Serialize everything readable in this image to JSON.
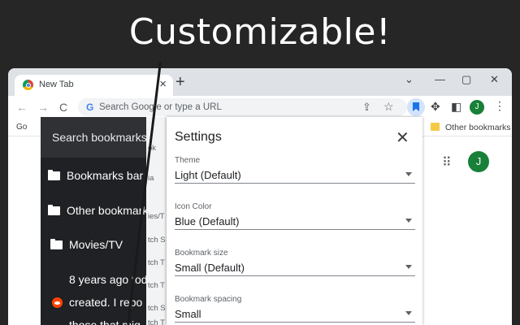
{
  "headline": "Customizable!",
  "tabstrip": {
    "tab_title": "New Tab",
    "tab_close": "×",
    "new_tab": "+",
    "window_controls": [
      "⌄",
      "—",
      "▢",
      "✕"
    ]
  },
  "toolbar": {
    "back": "←",
    "forward": "→",
    "reload": "C",
    "omnibox_placeholder": "Search Google or type a URL",
    "google_glyph": "G",
    "share_glyph": "⇪",
    "star_glyph": "☆",
    "extensions_glyph": "✥",
    "sidepanel_glyph": "◧",
    "avatar_letter": "J",
    "menu_glyph": "⋮"
  },
  "bookmarks_bar": {
    "left_fragment": "Go",
    "other_bookmarks": "Other bookmarks"
  },
  "ntp": {
    "apps_glyph": "⠿",
    "avatar_letter": "J"
  },
  "sidebar": {
    "search_placeholder": "Search bookmarks",
    "items": [
      {
        "label": "Bookmarks bar"
      },
      {
        "label": "Other bookmark"
      },
      {
        "label": "Movies/TV"
      }
    ],
    "post_lines": [
      "8 years ago tod",
      "created. I repo",
      "those that mig"
    ]
  },
  "strip_lines": [
    "ok",
    "ia",
    "ies/T",
    "tch S",
    "tch T",
    "tch T",
    "tch S",
    "tch T"
  ],
  "settings": {
    "title": "Settings",
    "close_glyph": "✕",
    "fields": [
      {
        "label": "Theme",
        "value": "Light (Default)"
      },
      {
        "label": "Icon Color",
        "value": "Blue (Default)"
      },
      {
        "label": "Bookmark size",
        "value": "Small (Default)"
      },
      {
        "label": "Bookmark spacing",
        "value": "Small"
      }
    ]
  },
  "colors": {
    "background": "#262626",
    "sidebar_dark": "#202124",
    "accent_blue": "#1a73e8",
    "avatar_green": "#188038",
    "folder_yellow": "#f6c945",
    "reddit_orange": "#ff4500"
  },
  "icons": [
    "chrome-icon",
    "google-icon",
    "share-icon",
    "star-icon",
    "bookmark-extension-icon",
    "puzzle-icon",
    "side-panel-icon",
    "kebab-menu-icon",
    "folder-icon",
    "apps-grid-icon",
    "reddit-icon",
    "close-icon",
    "chevron-down-icon"
  ]
}
